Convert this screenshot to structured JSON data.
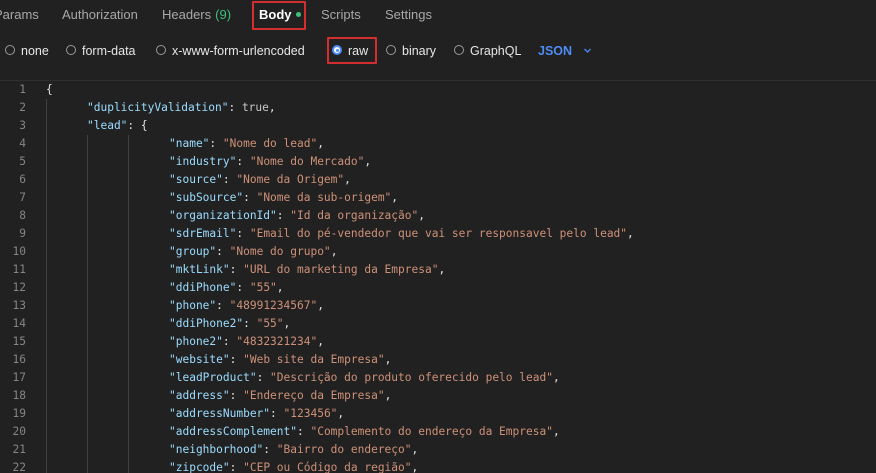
{
  "tabs": [
    {
      "label": "Params"
    },
    {
      "label": "Authorization"
    },
    {
      "label": "Headers",
      "count": "(9)"
    },
    {
      "label": "Body"
    },
    {
      "label": "Scripts"
    },
    {
      "label": "Settings"
    }
  ],
  "body_types": [
    {
      "label": "none"
    },
    {
      "label": "form-data"
    },
    {
      "label": "x-www-form-urlencoded"
    },
    {
      "label": "raw"
    },
    {
      "label": "binary"
    },
    {
      "label": "GraphQL"
    }
  ],
  "selected_body_type": "raw",
  "format_select": {
    "value": "JSON"
  },
  "colors": {
    "background": "#212121",
    "accent": "#4d8cf5",
    "indicator": "#3fbf7f",
    "highlight": "#d32f2f",
    "json_key": "#9cdcfe",
    "json_string": "#ce9178"
  },
  "editor": {
    "lines": [
      {
        "n": "1",
        "tokens": [
          {
            "t": "p",
            "v": "{"
          }
        ]
      },
      {
        "n": "2",
        "tokens": [
          {
            "t": "k",
            "v": "\"duplicityValidation\""
          },
          {
            "t": "p",
            "v": ": "
          },
          {
            "t": "b",
            "v": "true"
          },
          {
            "t": "p",
            "v": ","
          }
        ]
      },
      {
        "n": "3",
        "tokens": [
          {
            "t": "k",
            "v": "\"lead\""
          },
          {
            "t": "p",
            "v": ": {"
          }
        ]
      },
      {
        "n": "4",
        "tokens": [
          {
            "t": "k",
            "v": "\"name\""
          },
          {
            "t": "p",
            "v": ": "
          },
          {
            "t": "s",
            "v": "\"Nome do lead\""
          },
          {
            "t": "p",
            "v": ","
          }
        ]
      },
      {
        "n": "5",
        "tokens": [
          {
            "t": "k",
            "v": "\"industry\""
          },
          {
            "t": "p",
            "v": ": "
          },
          {
            "t": "s",
            "v": "\"Nome do Mercado\""
          },
          {
            "t": "p",
            "v": ","
          }
        ]
      },
      {
        "n": "6",
        "tokens": [
          {
            "t": "k",
            "v": "\"source\""
          },
          {
            "t": "p",
            "v": ": "
          },
          {
            "t": "s",
            "v": "\"Nome da Origem\""
          },
          {
            "t": "p",
            "v": ","
          }
        ]
      },
      {
        "n": "7",
        "tokens": [
          {
            "t": "k",
            "v": "\"subSource\""
          },
          {
            "t": "p",
            "v": ": "
          },
          {
            "t": "s",
            "v": "\"Nome da sub-origem\""
          },
          {
            "t": "p",
            "v": ","
          }
        ]
      },
      {
        "n": "8",
        "tokens": [
          {
            "t": "k",
            "v": "\"organizationId\""
          },
          {
            "t": "p",
            "v": ": "
          },
          {
            "t": "s",
            "v": "\"Id da organização\""
          },
          {
            "t": "p",
            "v": ","
          }
        ]
      },
      {
        "n": "9",
        "tokens": [
          {
            "t": "k",
            "v": "\"sdrEmail\""
          },
          {
            "t": "p",
            "v": ": "
          },
          {
            "t": "s",
            "v": "\"Email do pé-vendedor que vai ser responsavel pelo lead\""
          },
          {
            "t": "p",
            "v": ","
          }
        ]
      },
      {
        "n": "10",
        "tokens": [
          {
            "t": "k",
            "v": "\"group\""
          },
          {
            "t": "p",
            "v": ": "
          },
          {
            "t": "s",
            "v": "\"Nome do grupo\""
          },
          {
            "t": "p",
            "v": ","
          }
        ]
      },
      {
        "n": "11",
        "tokens": [
          {
            "t": "k",
            "v": "\"mktLink\""
          },
          {
            "t": "p",
            "v": ": "
          },
          {
            "t": "s",
            "v": "\"URL do marketing da Empresa\""
          },
          {
            "t": "p",
            "v": ","
          }
        ]
      },
      {
        "n": "12",
        "tokens": [
          {
            "t": "k",
            "v": "\"ddiPhone\""
          },
          {
            "t": "p",
            "v": ": "
          },
          {
            "t": "s",
            "v": "\"55\""
          },
          {
            "t": "p",
            "v": ","
          }
        ]
      },
      {
        "n": "13",
        "tokens": [
          {
            "t": "k",
            "v": "\"phone\""
          },
          {
            "t": "p",
            "v": ": "
          },
          {
            "t": "s",
            "v": "\"48991234567\""
          },
          {
            "t": "p",
            "v": ","
          }
        ]
      },
      {
        "n": "14",
        "tokens": [
          {
            "t": "k",
            "v": "\"ddiPhone2\""
          },
          {
            "t": "p",
            "v": ": "
          },
          {
            "t": "s",
            "v": "\"55\""
          },
          {
            "t": "p",
            "v": ","
          }
        ]
      },
      {
        "n": "15",
        "tokens": [
          {
            "t": "k",
            "v": "\"phone2\""
          },
          {
            "t": "p",
            "v": ": "
          },
          {
            "t": "s",
            "v": "\"4832321234\""
          },
          {
            "t": "p",
            "v": ","
          }
        ]
      },
      {
        "n": "16",
        "tokens": [
          {
            "t": "k",
            "v": "\"website\""
          },
          {
            "t": "p",
            "v": ": "
          },
          {
            "t": "s",
            "v": "\"Web site da Empresa\""
          },
          {
            "t": "p",
            "v": ","
          }
        ]
      },
      {
        "n": "17",
        "tokens": [
          {
            "t": "k",
            "v": "\"leadProduct\""
          },
          {
            "t": "p",
            "v": ": "
          },
          {
            "t": "s",
            "v": "\"Descrição do produto oferecido pelo lead\""
          },
          {
            "t": "p",
            "v": ","
          }
        ]
      },
      {
        "n": "18",
        "tokens": [
          {
            "t": "k",
            "v": "\"address\""
          },
          {
            "t": "p",
            "v": ": "
          },
          {
            "t": "s",
            "v": "\"Endereço da Empresa\""
          },
          {
            "t": "p",
            "v": ","
          }
        ]
      },
      {
        "n": "19",
        "tokens": [
          {
            "t": "k",
            "v": "\"addressNumber\""
          },
          {
            "t": "p",
            "v": ": "
          },
          {
            "t": "s",
            "v": "\"123456\""
          },
          {
            "t": "p",
            "v": ","
          }
        ]
      },
      {
        "n": "20",
        "tokens": [
          {
            "t": "k",
            "v": "\"addressComplement\""
          },
          {
            "t": "p",
            "v": ": "
          },
          {
            "t": "s",
            "v": "\"Complemento do endereço da Empresa\""
          },
          {
            "t": "p",
            "v": ","
          }
        ]
      },
      {
        "n": "21",
        "tokens": [
          {
            "t": "k",
            "v": "\"neighborhood\""
          },
          {
            "t": "p",
            "v": ": "
          },
          {
            "t": "s",
            "v": "\"Bairro do endereço\""
          },
          {
            "t": "p",
            "v": ","
          }
        ]
      },
      {
        "n": "22",
        "tokens": [
          {
            "t": "k",
            "v": "\"zipcode\""
          },
          {
            "t": "p",
            "v": ": "
          },
          {
            "t": "s",
            "v": "\"CEP ou Código da região\""
          },
          {
            "t": "p",
            "v": ","
          }
        ]
      }
    ]
  }
}
